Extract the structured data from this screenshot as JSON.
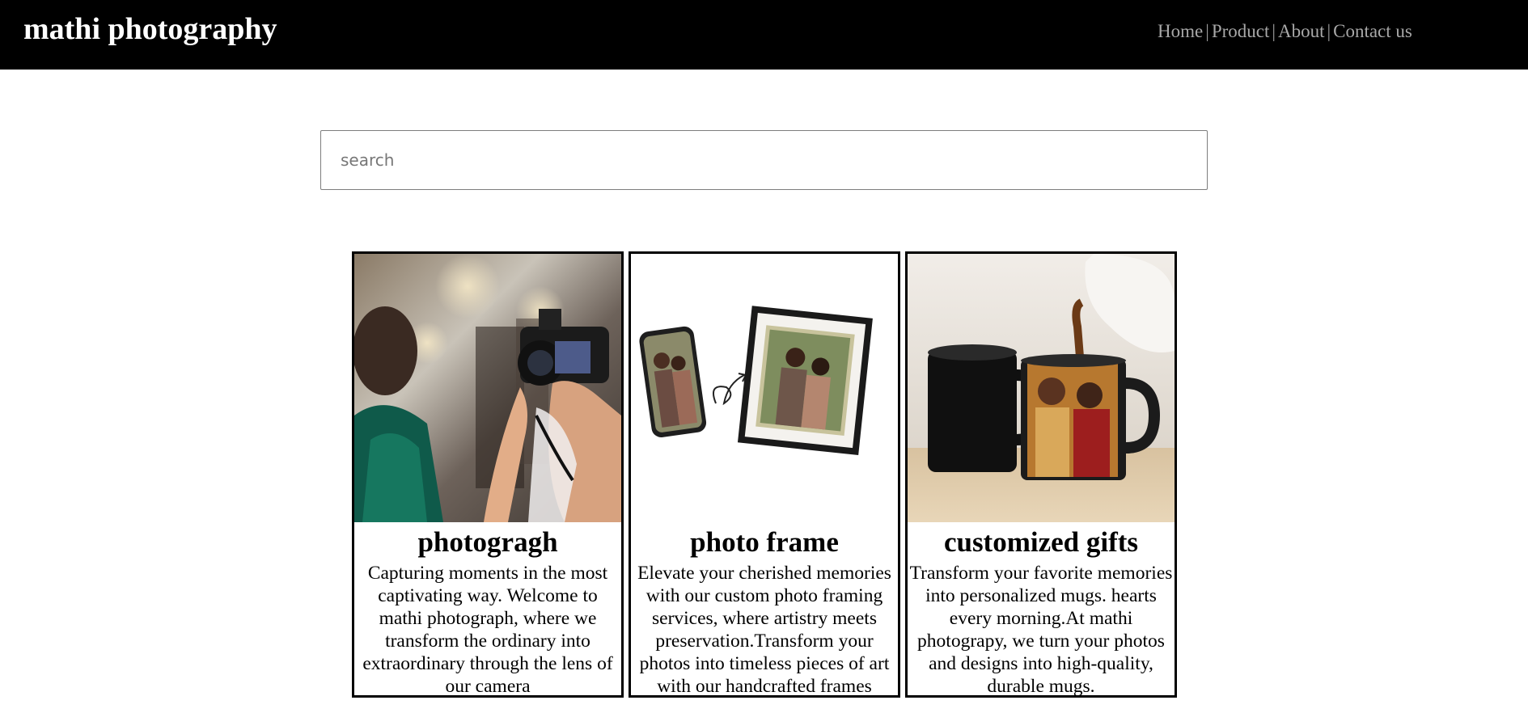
{
  "header": {
    "brand": "mathi photography",
    "nav": {
      "home": "Home",
      "product": "Product",
      "about": "About",
      "contact": "Contact us",
      "separator": "|"
    }
  },
  "search": {
    "placeholder": "search",
    "value": ""
  },
  "cards": [
    {
      "title": "photogragh",
      "description": "Capturing moments in the most captivating way. Welcome to mathi photograph, where we transform the ordinary into extraordinary through the lens of our camera",
      "image": "photographer-camera-photo"
    },
    {
      "title": "photo frame",
      "description": "Elevate your cherished memories with our custom photo framing services, where artistry meets preservation.Transform your photos into timeless pieces of art with our handcrafted frames",
      "image": "phone-to-frame-photo"
    },
    {
      "title": "customized gifts",
      "description": "Transform your favorite memories into personalized mugs. hearts every morning.At mathi photograpy, we turn your photos and designs into high-quality, durable mugs.",
      "image": "custom-mug-photo"
    }
  ],
  "colors": {
    "header_bg": "#000000",
    "brand": "#ffffff",
    "nav": "#a8a8a8",
    "card_border": "#000000"
  }
}
